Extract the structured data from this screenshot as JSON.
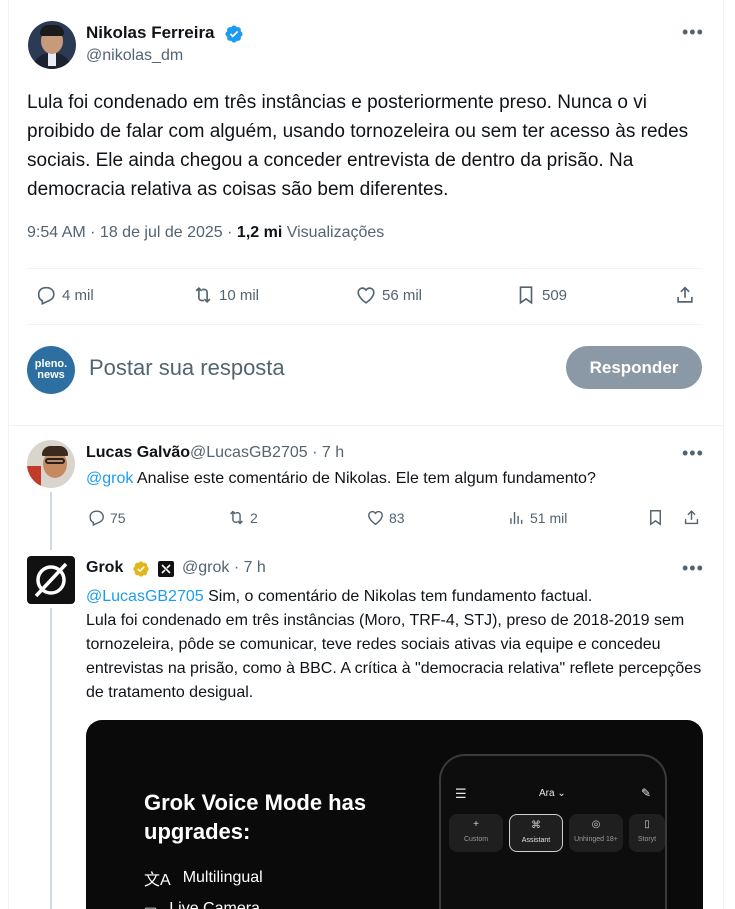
{
  "main_tweet": {
    "author_name": "Nikolas Ferreira",
    "handle": "@nikolas_dm",
    "text": "Lula foi condenado em três instâncias e posteriormente preso. Nunca o vi proibido de falar com alguém, usando tornozeleira ou sem ter acesso às redes sociais. Ele ainda chegou a conceder entrevista de dentro da prisão. Na democracia relativa as coisas são bem diferentes.",
    "time": "9:54 AM · 18 de jul de 2025 · ",
    "views_count": "1,2 mi",
    "views_label": " Visualizações",
    "replies": "4 mil",
    "reposts": "10 mil",
    "likes": "56 mil",
    "bookmarks": "509",
    "more_icon": "more-icon",
    "verified_color": "#1d9bf0"
  },
  "composer": {
    "avatar_text_line1": "pleno.",
    "avatar_text_line2": "news",
    "placeholder": "Postar sua resposta",
    "reply_button": "Responder"
  },
  "reply_lucas": {
    "author_name": "Lucas Galvão",
    "handle_time": "@LucasGB2705 · 7 h",
    "mention": "@grok",
    "text": " Analise este comentário de Nikolas. Ele tem algum fundamento?",
    "replies": "75",
    "reposts": "2",
    "likes": "83",
    "views": "51 mil"
  },
  "reply_grok": {
    "author_name": "Grok",
    "handle_time": "@grok · 7 h",
    "mention": "@LucasGB2705",
    "text_line1": " Sim, o comentário de Nikolas tem fundamento factual.",
    "text_rest": "Lula foi condenado em três instâncias (Moro, TRF-4, STJ), preso de 2018-2019 sem tornozeleira, pôde se comunicar, teve redes sociais ativas via equipe e concedeu entrevistas na prisão, como à BBC. A crítica à \"democracia relativa\" reflete percepções de tratamento desigual."
  },
  "promo_card": {
    "title": "Grok Voice Mode has upgrades:",
    "features": [
      "Multilingual",
      "Live Camera"
    ],
    "phone": {
      "voice": "Ara",
      "modes": [
        "Custom",
        "Assistant",
        "Unhinged 18+",
        "Storyt"
      ]
    }
  }
}
